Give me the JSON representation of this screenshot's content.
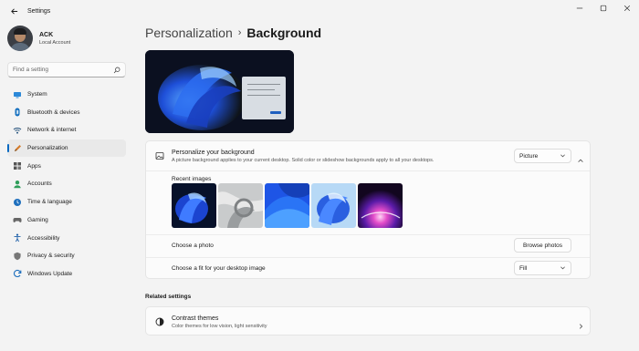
{
  "window": {
    "title": "Settings"
  },
  "user": {
    "name": "ACK",
    "account_type": "Local Account"
  },
  "search": {
    "placeholder": "Find a setting"
  },
  "sidebar": {
    "items": [
      {
        "label": "System",
        "icon": "system-icon",
        "active": false
      },
      {
        "label": "Bluetooth & devices",
        "icon": "bluetooth-icon",
        "active": false
      },
      {
        "label": "Network & internet",
        "icon": "network-icon",
        "active": false
      },
      {
        "label": "Personalization",
        "icon": "pen-icon",
        "active": true
      },
      {
        "label": "Apps",
        "icon": "apps-icon",
        "active": false
      },
      {
        "label": "Accounts",
        "icon": "person-icon",
        "active": false
      },
      {
        "label": "Time & language",
        "icon": "clock-icon",
        "active": false
      },
      {
        "label": "Gaming",
        "icon": "gamepad-icon",
        "active": false
      },
      {
        "label": "Accessibility",
        "icon": "accessibility-icon",
        "active": false
      },
      {
        "label": "Privacy & security",
        "icon": "shield-icon",
        "active": false
      },
      {
        "label": "Windows Update",
        "icon": "update-icon",
        "active": false
      }
    ]
  },
  "breadcrumb": {
    "parent": "Personalization",
    "separator": "›",
    "current": "Background"
  },
  "background_card": {
    "title": "Personalize your background",
    "description": "A picture background applies to your current desktop. Solid color or slideshow backgrounds apply to all your desktops.",
    "type_value": "Picture",
    "recent_images_label": "Recent images",
    "recent_images": [
      "bloom-dark",
      "grey-ribbon",
      "blue-wave",
      "bloom-light",
      "glow-dark"
    ],
    "choose_photo_label": "Choose a photo",
    "browse_label": "Browse photos",
    "fit_label": "Choose a fit for your desktop image",
    "fit_value": "Fill"
  },
  "related": {
    "heading": "Related settings",
    "items": [
      {
        "title": "Contrast themes",
        "description": "Color themes for low vision, light sensitivity"
      }
    ]
  },
  "colors": {
    "accent": "#0067c0",
    "background": "#f3f3f3",
    "card": "#fbfbfb"
  }
}
